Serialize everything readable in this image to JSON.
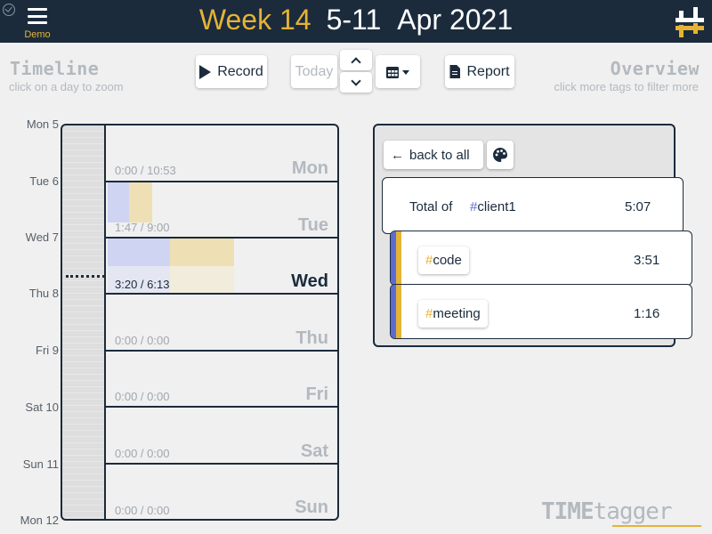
{
  "header": {
    "demo_label": "Demo",
    "week": "Week 14",
    "date_range": "5-11",
    "month_year": "Apr 2021"
  },
  "toolbar": {
    "timeline_title": "Timeline",
    "timeline_hint": "click on a day to zoom",
    "record_label": "Record",
    "today_label": "Today",
    "report_label": "Report",
    "overview_title": "Overview",
    "overview_hint": "click more tags to filter more"
  },
  "timeline": {
    "ruler_labels": [
      "Mon 5",
      "Tue 6",
      "Wed 7",
      "Thu 8",
      "Fri 9",
      "Sat 10",
      "Sun 11",
      "Mon 12"
    ],
    "days": [
      {
        "name": "Mon",
        "time": "0:00 / 10:53"
      },
      {
        "name": "Tue",
        "time": "1:47 / 9:00"
      },
      {
        "name": "Wed",
        "time": "3:20 / 6:13"
      },
      {
        "name": "Thu",
        "time": "0:00 / 0:00"
      },
      {
        "name": "Fri",
        "time": "0:00 / 0:00"
      },
      {
        "name": "Sat",
        "time": "0:00 / 0:00"
      },
      {
        "name": "Sun",
        "time": "0:00 / 0:00"
      }
    ],
    "current_day": "Wed"
  },
  "overview": {
    "back_label": "back to all",
    "total_prefix": "Total of",
    "total_tag": "client1",
    "total_time": "5:07",
    "tags": [
      {
        "tag": "code",
        "time": "3:51"
      },
      {
        "tag": "meeting",
        "time": "1:16"
      }
    ]
  },
  "brand": {
    "bold": "TIME",
    "light": "tagger"
  },
  "colors": {
    "navy": "#1b2b3c",
    "gold": "#e5b335",
    "tag_blue": "#5b6bd1",
    "muted": "#b3b9bf"
  }
}
